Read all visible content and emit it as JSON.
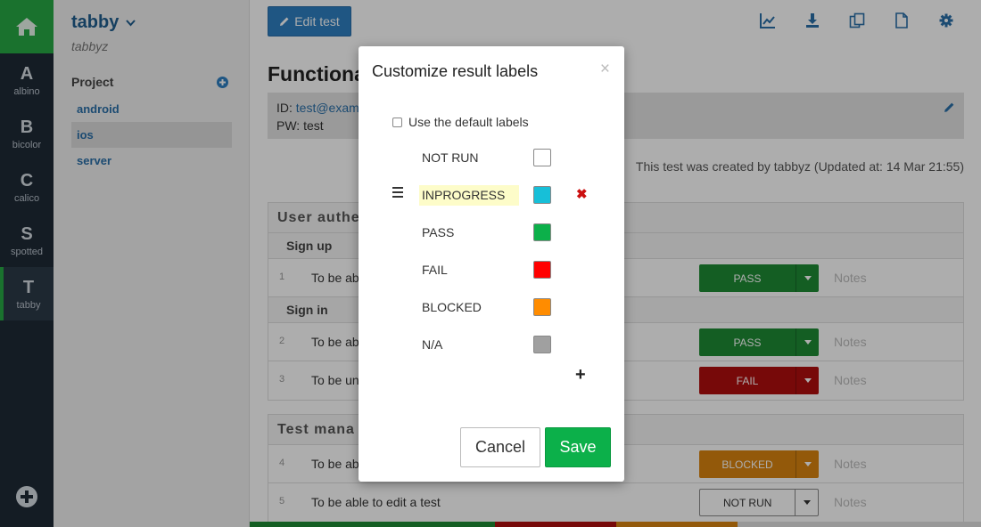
{
  "rail": {
    "items": [
      {
        "letter": "A",
        "label": "albino",
        "active": false
      },
      {
        "letter": "B",
        "label": "bicolor",
        "active": false
      },
      {
        "letter": "C",
        "label": "calico",
        "active": false
      },
      {
        "letter": "S",
        "label": "spotted",
        "active": false
      },
      {
        "letter": "T",
        "label": "tabby",
        "active": true
      }
    ]
  },
  "sidebar": {
    "workspace_name": "tabby",
    "workspace_user": "tabbyz",
    "projects_heading": "Project",
    "projects": [
      {
        "label": "android",
        "active": false
      },
      {
        "label": "ios",
        "active": true
      },
      {
        "label": "server",
        "active": false
      }
    ]
  },
  "main": {
    "edit_button": "Edit test",
    "title": "Functiona",
    "info": {
      "id_label": "ID: ",
      "id_value": "test@examp",
      "pw_line": "PW: test"
    },
    "created_text": "This test was created by tabbyz (Updated at: 14 Mar 21:55)",
    "notes_placeholder": "Notes",
    "sections": [
      {
        "title": "User authe",
        "groups": [
          {
            "title": "Sign up",
            "cases": [
              {
                "num": "1",
                "title": "To be ab",
                "status": "PASS",
                "color": "#1e8b34",
                "outline": false
              }
            ]
          },
          {
            "title": "Sign in",
            "cases": [
              {
                "num": "2",
                "title": "To be ab",
                "status": "PASS",
                "color": "#1e8b34",
                "outline": false
              },
              {
                "num": "3",
                "title": "To be un",
                "status": "FAIL",
                "color": "#b00e0e",
                "outline": false
              }
            ]
          }
        ]
      },
      {
        "title": "Test mana",
        "groups": [
          {
            "title": "",
            "cases": [
              {
                "num": "4",
                "title": "To be ab",
                "status": "BLOCKED",
                "color": "#d9840f",
                "outline": false
              },
              {
                "num": "5",
                "title": "To be able to edit a test",
                "status": "NOT RUN",
                "color": "#ffffff",
                "outline": true
              }
            ]
          }
        ]
      }
    ],
    "progress": [
      {
        "color": "#1e8b34",
        "fraction": 0.335
      },
      {
        "color": "#b00e0e",
        "fraction": 0.166
      },
      {
        "color": "#d9840f",
        "fraction": 0.166
      },
      {
        "color": "#e0e0e0",
        "fraction": 0.333
      }
    ]
  },
  "modal": {
    "title": "Customize result labels",
    "close_glyph": "×",
    "default_labels_text": "Use the default labels",
    "default_labels_checked": false,
    "labels": [
      {
        "name": "NOT RUN",
        "color": "#ffffff",
        "editing": false,
        "deletable": false
      },
      {
        "name": "INPROGRESS",
        "color": "#17bfd8",
        "editing": true,
        "deletable": true
      },
      {
        "name": "PASS",
        "color": "#0cb04a",
        "editing": false,
        "deletable": false
      },
      {
        "name": "FAIL",
        "color": "#ff0000",
        "editing": false,
        "deletable": false
      },
      {
        "name": "BLOCKED",
        "color": "#ff8c00",
        "editing": false,
        "deletable": false
      },
      {
        "name": "N/A",
        "color": "#a0a0a0",
        "editing": false,
        "deletable": false
      }
    ],
    "delete_glyph": "✖",
    "add_glyph": "+",
    "cancel_label": "Cancel",
    "save_label": "Save"
  },
  "icons": [
    "home-icon",
    "plus-circle-icon",
    "chevron-down-icon",
    "pencil-icon",
    "chart-icon",
    "download-icon",
    "copy-icon",
    "file-icon",
    "gear-icon",
    "caret-down-icon",
    "drag-handle-icon",
    "delete-icon",
    "add-icon"
  ]
}
